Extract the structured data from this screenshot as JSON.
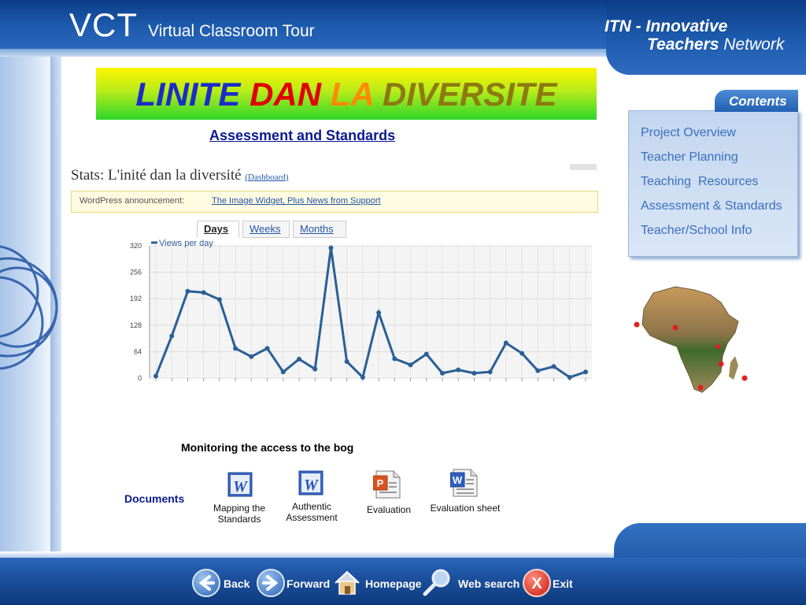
{
  "header": {
    "logo": "VCT",
    "logo_subtitle": "Virtual Classroom Tour",
    "network_line1": "ITN - Innovative",
    "network_line2_bold": "Teachers",
    "network_line2_rest": "Network"
  },
  "banner": {
    "word1": "LINITE",
    "word2": "DAN",
    "word3": "LA",
    "word4": "DIVERSITE"
  },
  "page_subtitle": "Assessment and Standards",
  "contents": {
    "tab_label": "Contents",
    "items": [
      {
        "label": "Project Overview"
      },
      {
        "label": "Teacher Planning"
      },
      {
        "label": "Teaching  Resources"
      },
      {
        "label": "Assessment & Standards"
      },
      {
        "label": "Teacher/School Info"
      }
    ]
  },
  "stats": {
    "title": "Stats: L'inité dan la diversité",
    "dashboard_link": "Dashboard",
    "announcement_label": "WordPress announcement:",
    "announcement_link": "The Image Widget, Plus News from Support",
    "tabs": [
      "Days",
      "Weeks",
      "Months"
    ],
    "active_tab": "Days"
  },
  "chart_data": {
    "type": "line",
    "legend": "Views per day",
    "ylim": [
      0,
      320
    ],
    "yticks": [
      0,
      64,
      128,
      192,
      256,
      320
    ],
    "series": [
      {
        "name": "Views per day",
        "values": [
          5,
          102,
          210,
          207,
          190,
          72,
          52,
          72,
          15,
          46,
          22,
          315,
          40,
          2,
          158,
          47,
          32,
          58,
          12,
          20,
          12,
          15,
          85,
          60,
          18,
          28,
          2,
          15
        ]
      }
    ],
    "color": "#2a5f96"
  },
  "caption": "Monitoring the access to the bog",
  "documents": {
    "label": "Documents",
    "items": [
      {
        "line1": "Mapping the",
        "line2": "Standards",
        "icon": "word-doc-icon"
      },
      {
        "line1": "Authentic",
        "line2": "Assessment",
        "icon": "word-doc-icon"
      },
      {
        "line1": "Evaluation",
        "line2": "",
        "icon": "powerpoint-doc-icon"
      },
      {
        "line1": "Evaluation sheet",
        "line2": "",
        "icon": "word-doc-icon"
      }
    ]
  },
  "bottom_nav": {
    "back": "Back",
    "forward": "Forward",
    "homepage": "Homepage",
    "web_search": "Web search",
    "exit": "Exit"
  }
}
